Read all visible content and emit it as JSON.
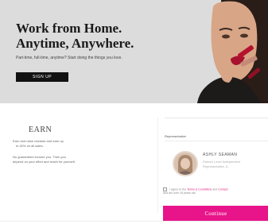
{
  "hero": {
    "title_line1": "Work from Home.",
    "title_line2": "Anytime, Anywhere.",
    "subtitle": "Part-time, full-time, anytime? Start doing the things you love.",
    "button_label": "SIGN UP"
  },
  "earn": {
    "title": "EARN",
    "para1_line1": "Earn and raise rewards and earn up",
    "para1_line2": "to 40% on all sales.",
    "para2_line1": "No guaranteed income you. Then you",
    "para2_line2": "depend on your effort and reach for yourself."
  },
  "panel": {
    "label": "Representative",
    "rep_name": "ASHLY SEAMAN",
    "rep_detail1": "Partner Level Independent",
    "rep_detail2": "Representative, IL",
    "agree_text_pre": "I agree to the",
    "agree_link1": "Terms & Conditions",
    "agree_text_mid": "and",
    "agree_link2": "Contact",
    "agree_text_line2": "and am over 18 years old.",
    "continue_label": "Continue"
  },
  "colors": {
    "accent": "#e8148a",
    "hero_bg": "#dcdcdc",
    "button_dark": "#111111"
  }
}
